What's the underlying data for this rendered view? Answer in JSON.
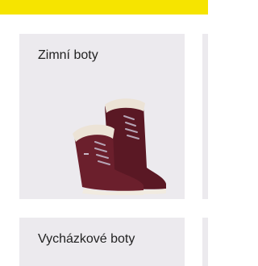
{
  "categories": [
    {
      "title": "Zimní boty",
      "image": "burgundy-winter-boots-image"
    },
    {
      "title": "Vycházkové boty"
    }
  ],
  "colors": {
    "top_bar": "#f6e400",
    "card_bg": "#eceaee",
    "boot": "#6b1f2c"
  }
}
